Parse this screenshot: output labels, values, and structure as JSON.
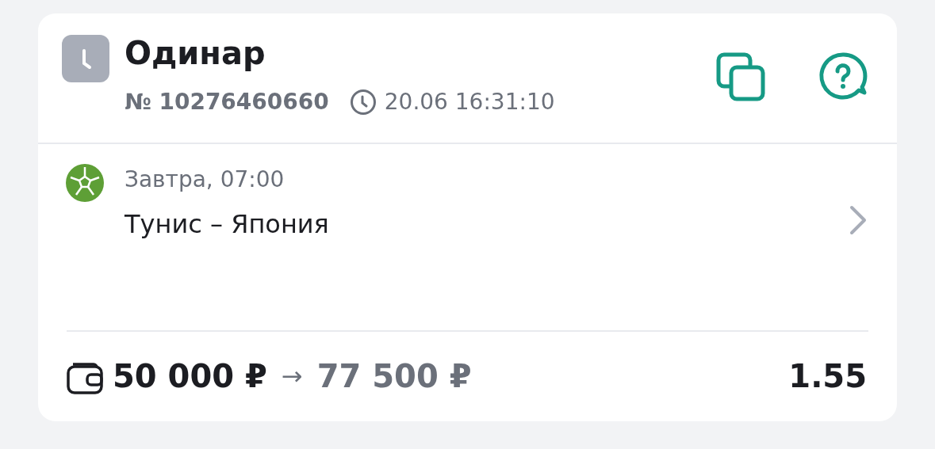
{
  "bet": {
    "title": "Одинар",
    "number": "№ 10276460660",
    "placed_at": "20.06 16:31:10"
  },
  "event": {
    "time": "Завтра, 07:00",
    "name": "Тунис – Япония"
  },
  "footer": {
    "stake": "50 000 ₽",
    "arrow": "→",
    "payout": "77 500 ₽",
    "odds": "1.55"
  }
}
